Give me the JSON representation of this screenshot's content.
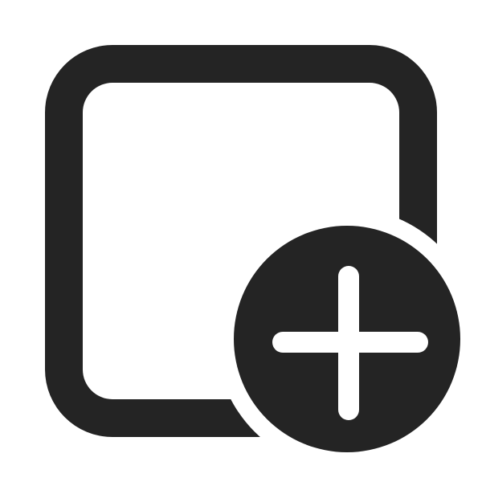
{
  "icon": {
    "name": "square-add-icon",
    "glyph_color": "#242424",
    "background_color": "#ffffff",
    "parts": {
      "square": "square-outline",
      "badge": "add-circle-badge",
      "plus": "plus-sign"
    }
  }
}
